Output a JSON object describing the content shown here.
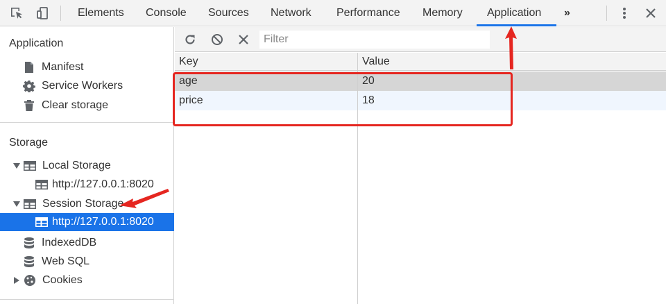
{
  "toolbar": {
    "tabs": [
      "Elements",
      "Console",
      "Sources",
      "Network",
      "Performance",
      "Memory",
      "Application"
    ],
    "active_tab": "Application",
    "more_label": "»"
  },
  "sidebar": {
    "application": {
      "title": "Application",
      "items": [
        "Manifest",
        "Service Workers",
        "Clear storage"
      ]
    },
    "storage": {
      "title": "Storage",
      "local_storage": "Local Storage",
      "local_origin": "http://127.0.0.1:8020",
      "session_storage": "Session Storage",
      "session_origin": "http://127.0.0.1:8020",
      "indexeddb": "IndexedDB",
      "websql": "Web SQL",
      "cookies": "Cookies"
    }
  },
  "main": {
    "filter_placeholder": "Filter",
    "columns": {
      "key": "Key",
      "value": "Value"
    },
    "rows": [
      {
        "key": "age",
        "value": "20"
      },
      {
        "key": "price",
        "value": "18"
      }
    ]
  },
  "colors": {
    "accent": "#1a73e8",
    "annotation": "#e52620",
    "selected_row": "#d6d6d6",
    "alt_row": "#f0f6fe"
  }
}
